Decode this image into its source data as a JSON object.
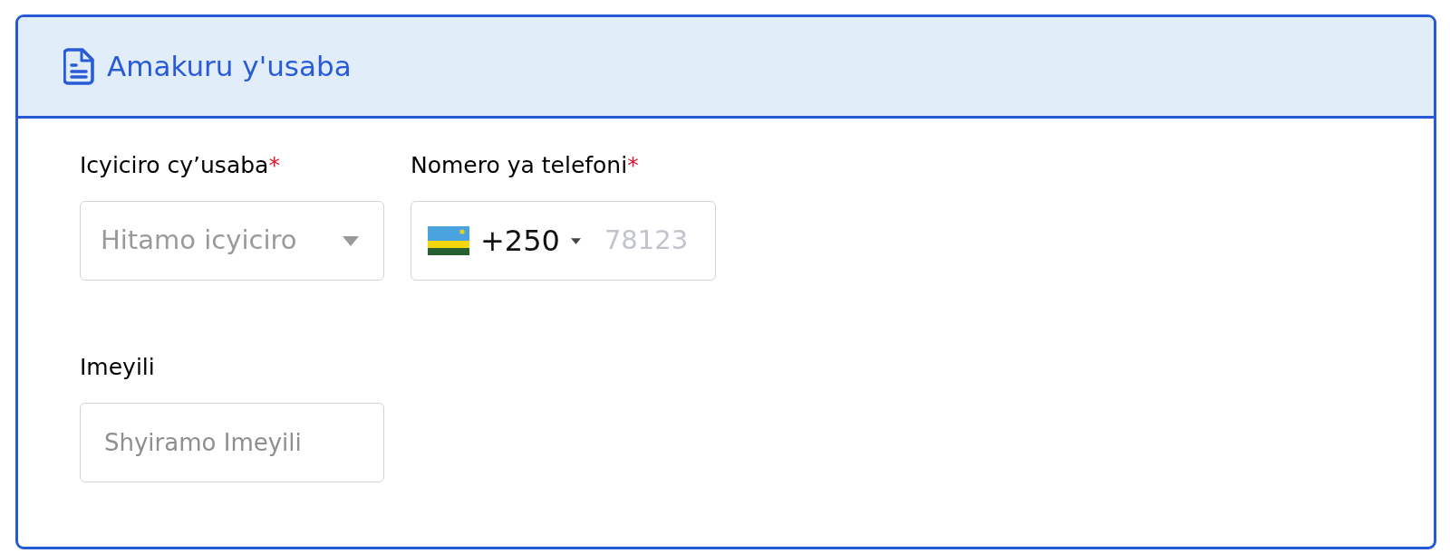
{
  "card": {
    "title": "Amakuru y'usaba"
  },
  "rows": [
    {
      "fields": [
        {
          "kind": "select",
          "label": "Icyiciro cy’usaba",
          "required_mark": "*",
          "placeholder": "Hitamo icyiciro"
        },
        {
          "kind": "phone",
          "label": "Nomero ya telefoni",
          "required_mark": "*",
          "country_code": "+250",
          "placeholder": "78123"
        }
      ]
    },
    {
      "fields": [
        {
          "kind": "text",
          "label": "Imeyili",
          "placeholder": "Shyiramo Imeyili"
        }
      ]
    }
  ]
}
